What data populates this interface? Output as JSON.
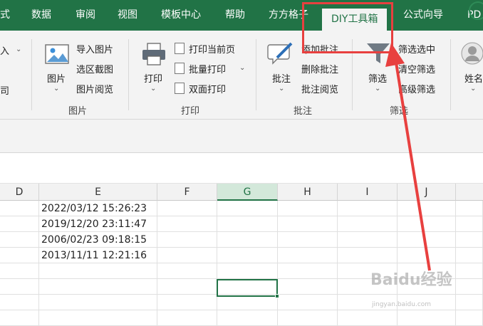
{
  "tabs": [
    {
      "label": "式"
    },
    {
      "label": "数据"
    },
    {
      "label": "审阅"
    },
    {
      "label": "视图"
    },
    {
      "label": "模板中心"
    },
    {
      "label": "帮助"
    },
    {
      "label": "方方格子"
    },
    {
      "label": "DIY工具箱"
    },
    {
      "label": "公式向导"
    },
    {
      "label": "PD"
    }
  ],
  "ribbon": {
    "left_fragments": [
      "入",
      "司"
    ],
    "picture_group": {
      "big_label": "图片",
      "items": [
        "导入图片",
        "选区截图",
        "图片阅览"
      ],
      "group_label": "图片"
    },
    "print_group": {
      "big_label": "打印",
      "items": [
        "打印当前页",
        "批量打印",
        "双面打印"
      ],
      "group_label": "打印"
    },
    "comment_group": {
      "big_label": "批注",
      "items": [
        "添加批注",
        "删除批注",
        "批注阅览"
      ],
      "group_label": "批注"
    },
    "filter_group": {
      "big_label": "筛选",
      "items": [
        "筛选选中",
        "清空筛选",
        "高级筛选"
      ],
      "group_label": "筛选"
    },
    "name_group": {
      "big_label": "姓名"
    }
  },
  "grid": {
    "columns": [
      "D",
      "E",
      "F",
      "G",
      "H",
      "I",
      "J"
    ],
    "selected_column": "G",
    "e_values": [
      "2022/03/12 15:26:23",
      "2019/12/20 23:11:47",
      "2006/02/23 09:18:15",
      "2013/11/11 12:21:16"
    ]
  },
  "watermark": {
    "main": "Baidu经验",
    "sub": "jingyan.baidu.com"
  },
  "colors": {
    "accent": "#217346",
    "highlight": "#e8403f"
  }
}
